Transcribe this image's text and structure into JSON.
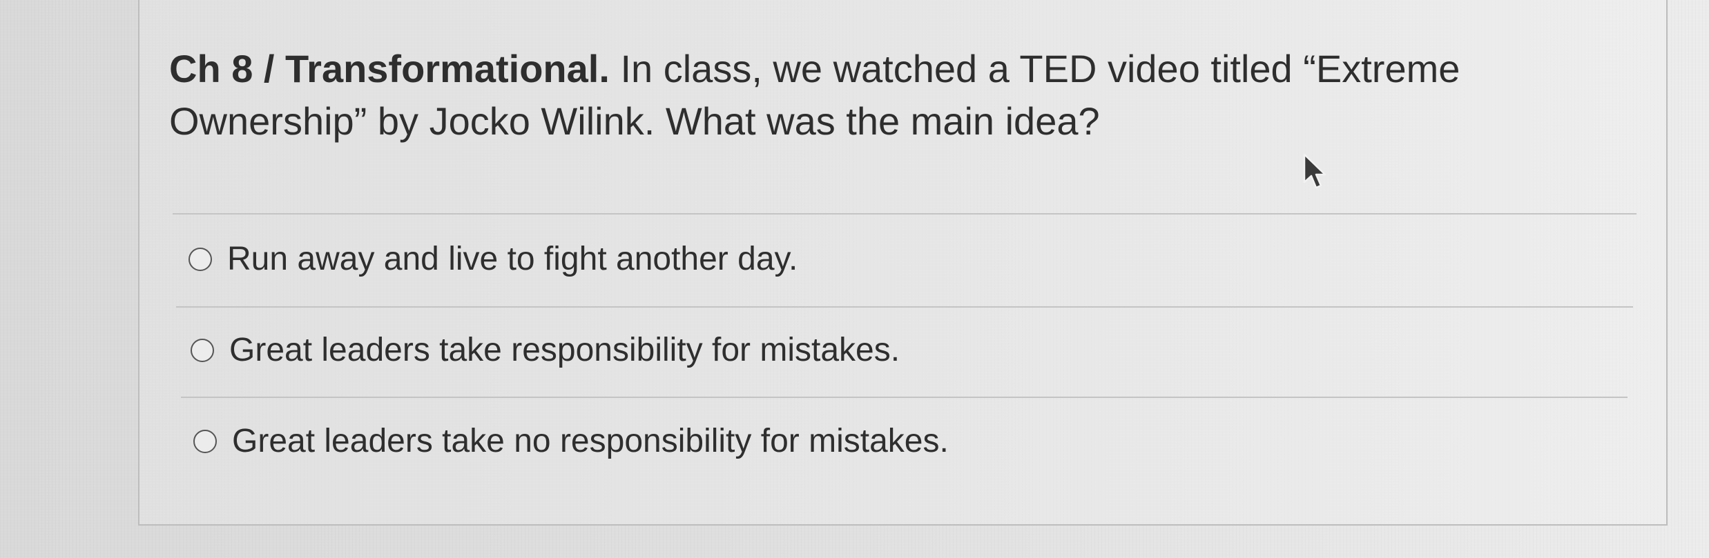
{
  "question": {
    "prefix": "Ch 8 / Transformational.",
    "text": "In class, we watched a TED video titled “Extreme Ownership” by Jocko Wilink. What was the main idea?"
  },
  "options": [
    {
      "label": "Run away and live to fight another day.",
      "selected": false
    },
    {
      "label": "Great leaders take responsibility for mistakes.",
      "selected": false
    },
    {
      "label": "Great leaders take no responsibility for mistakes.",
      "selected": false
    }
  ],
  "icons": {
    "cursor": "mouse-pointer-icon",
    "radio": "radio-button-icon"
  },
  "colors": {
    "text": "#2e2e2e",
    "divider": "#c4c4c4",
    "background": "#e0e0e0"
  }
}
